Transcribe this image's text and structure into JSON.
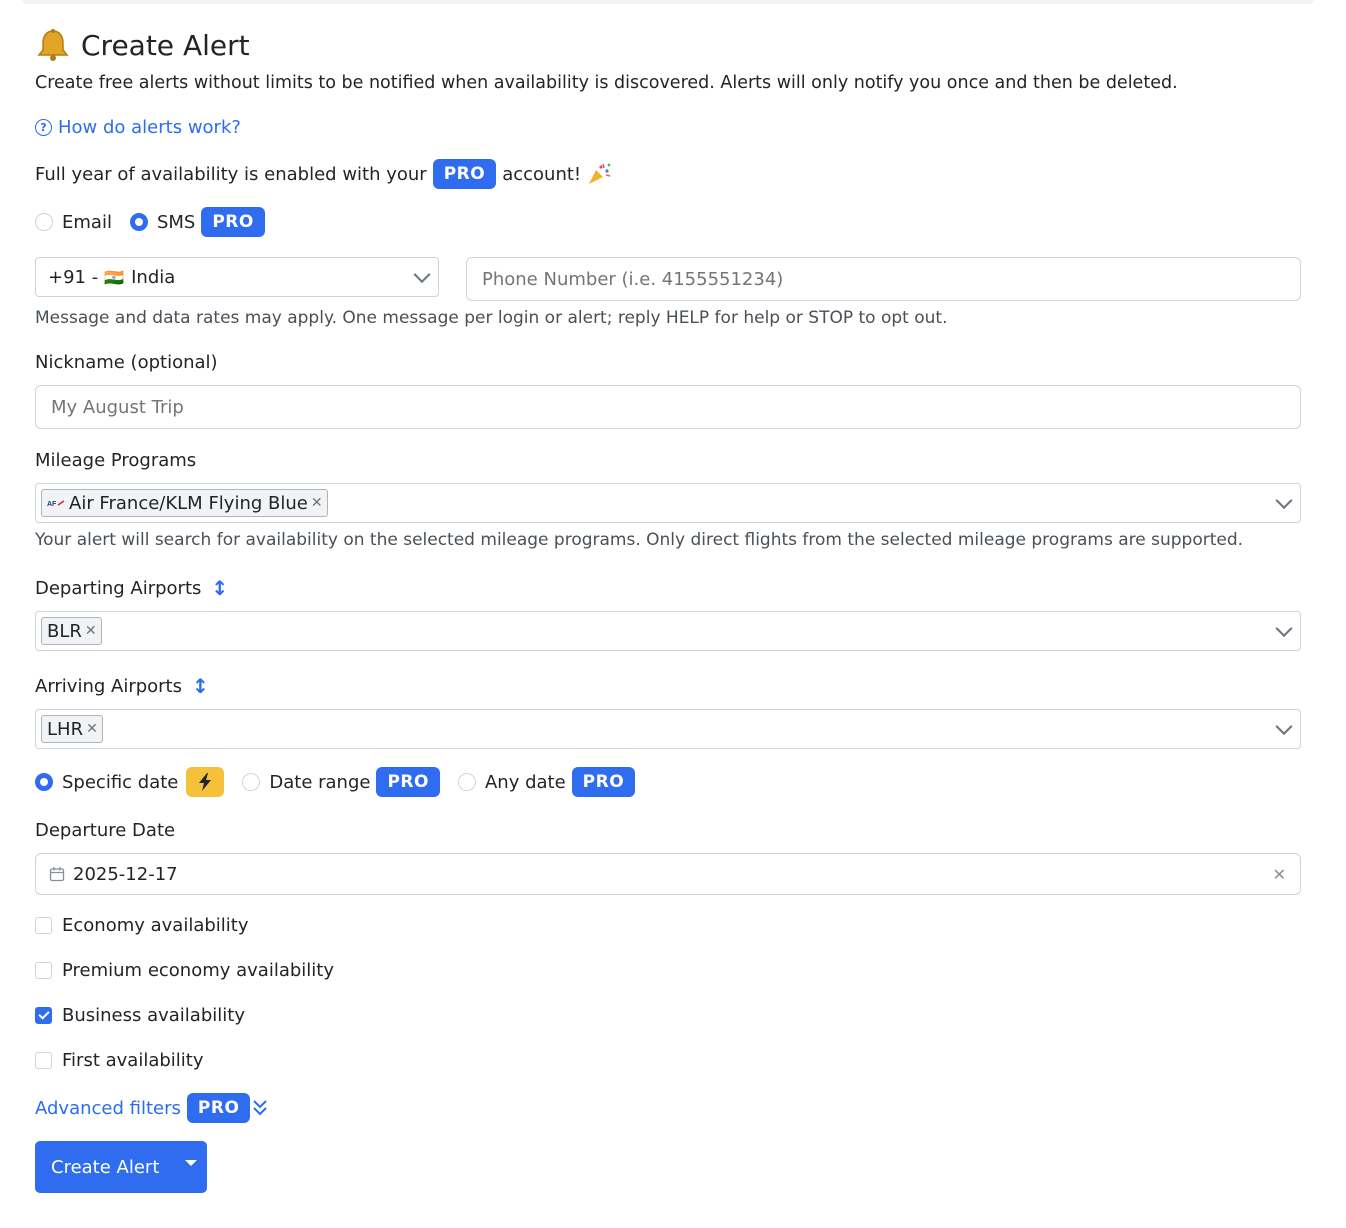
{
  "header": {
    "title": "Create Alert",
    "subtitle": "Create free alerts without limits to be notified when availability is discovered. Alerts will only notify you once and then be deleted.",
    "help_link": "How do alerts work?"
  },
  "pro_notice": {
    "before": "Full year of availability is enabled with your",
    "badge": "PRO",
    "after": "account!"
  },
  "notify_method": {
    "email_label": "Email",
    "sms_label": "SMS",
    "sms_badge": "PRO",
    "selected": "SMS"
  },
  "phone": {
    "country_code": "+91 -",
    "country_flag": "🇮🇳",
    "country_name": "India",
    "placeholder": "Phone Number (i.e. 4155551234)",
    "value": "",
    "disclaimer": "Message and data rates may apply. One message per login or alert; reply HELP for help or STOP to opt out."
  },
  "nickname": {
    "label": "Nickname (optional)",
    "placeholder": "My August Trip",
    "value": ""
  },
  "mileage_programs": {
    "label": "Mileage Programs",
    "selected": [
      "Air France/KLM Flying Blue"
    ],
    "help": "Your alert will search for availability on the selected mileage programs. Only direct flights from the selected mileage programs are supported."
  },
  "departing": {
    "label": "Departing Airports",
    "selected": [
      "BLR"
    ]
  },
  "arriving": {
    "label": "Arriving Airports",
    "selected": [
      "LHR"
    ]
  },
  "date_mode": {
    "specific_label": "Specific date",
    "range_label": "Date range",
    "range_badge": "PRO",
    "any_label": "Any date",
    "any_badge": "PRO",
    "selected": "Specific date"
  },
  "departure_date": {
    "label": "Departure Date",
    "value": "2025-12-17"
  },
  "cabins": [
    {
      "label": "Economy availability",
      "checked": false
    },
    {
      "label": "Premium economy availability",
      "checked": false
    },
    {
      "label": "Business availability",
      "checked": true
    },
    {
      "label": "First availability",
      "checked": false
    }
  ],
  "advanced": {
    "label": "Advanced filters",
    "badge": "PRO"
  },
  "submit": {
    "label": "Create Alert"
  },
  "colors": {
    "accent": "#2f6cf0",
    "link": "#2b6cf0",
    "flash_badge": "#f5c13b"
  },
  "icons": {
    "title": "bell-icon",
    "help": "question-circle-icon",
    "celebrate": "party-popper-icon",
    "calendar": "calendar-icon",
    "clear": "close-icon",
    "sort": "up-down-arrow-icon",
    "flash": "lightning-icon",
    "advanced": "double-chevron-down-icon"
  }
}
